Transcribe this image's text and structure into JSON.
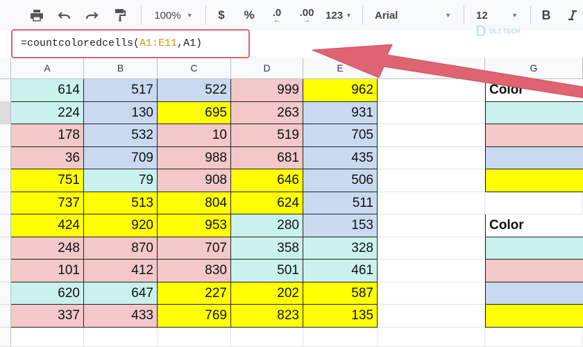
{
  "toolbar": {
    "zoom": "100%",
    "currency": "$",
    "percent": "%",
    "decrease_decimal": ".0",
    "increase_decimal": ".00",
    "more_formats": "123",
    "font": "Arial",
    "font_size": "12",
    "bold": "B"
  },
  "formula_bar": {
    "prefix": "=countcoloredcells(",
    "range": "A1:E11",
    "separator": ",",
    "color_ref": "A1",
    "suffix": ")"
  },
  "watermark": {
    "mark": "D",
    "text": "DLZ TECH"
  },
  "columns": [
    "A",
    "B",
    "C",
    "D",
    "E",
    "F",
    "G"
  ],
  "colors": {
    "cyan": "#c9f2ec",
    "blue": "#c9daf0",
    "pink": "#f2c8c8",
    "yellow": "#ffff00",
    "arrow": "#e06371"
  },
  "grid": [
    [
      {
        "v": "614",
        "c": "cyan"
      },
      {
        "v": "517",
        "c": "blue"
      },
      {
        "v": "522",
        "c": "blue"
      },
      {
        "v": "999",
        "c": "pink"
      },
      {
        "v": "962",
        "c": "yellow"
      }
    ],
    [
      {
        "v": "224",
        "c": "cyan"
      },
      {
        "v": "130",
        "c": "blue"
      },
      {
        "v": "695",
        "c": "yellow"
      },
      {
        "v": "263",
        "c": "pink"
      },
      {
        "v": "931",
        "c": "blue"
      }
    ],
    [
      {
        "v": "178",
        "c": "pink"
      },
      {
        "v": "532",
        "c": "blue"
      },
      {
        "v": "10",
        "c": "pink"
      },
      {
        "v": "519",
        "c": "pink"
      },
      {
        "v": "705",
        "c": "blue"
      }
    ],
    [
      {
        "v": "36",
        "c": "pink"
      },
      {
        "v": "709",
        "c": "blue"
      },
      {
        "v": "988",
        "c": "pink"
      },
      {
        "v": "681",
        "c": "pink"
      },
      {
        "v": "435",
        "c": "blue"
      }
    ],
    [
      {
        "v": "751",
        "c": "yellow"
      },
      {
        "v": "79",
        "c": "cyan"
      },
      {
        "v": "908",
        "c": "pink"
      },
      {
        "v": "646",
        "c": "yellow"
      },
      {
        "v": "506",
        "c": "blue"
      }
    ],
    [
      {
        "v": "737",
        "c": "yellow"
      },
      {
        "v": "513",
        "c": "yellow"
      },
      {
        "v": "804",
        "c": "yellow"
      },
      {
        "v": "624",
        "c": "yellow"
      },
      {
        "v": "511",
        "c": "blue"
      }
    ],
    [
      {
        "v": "424",
        "c": "yellow"
      },
      {
        "v": "920",
        "c": "yellow"
      },
      {
        "v": "953",
        "c": "yellow"
      },
      {
        "v": "280",
        "c": "cyan"
      },
      {
        "v": "153",
        "c": "blue"
      }
    ],
    [
      {
        "v": "248",
        "c": "pink"
      },
      {
        "v": "870",
        "c": "pink"
      },
      {
        "v": "707",
        "c": "pink"
      },
      {
        "v": "358",
        "c": "cyan"
      },
      {
        "v": "328",
        "c": "cyan"
      }
    ],
    [
      {
        "v": "101",
        "c": "pink"
      },
      {
        "v": "412",
        "c": "pink"
      },
      {
        "v": "830",
        "c": "pink"
      },
      {
        "v": "501",
        "c": "cyan"
      },
      {
        "v": "461",
        "c": "cyan"
      }
    ],
    [
      {
        "v": "620",
        "c": "cyan"
      },
      {
        "v": "647",
        "c": "cyan"
      },
      {
        "v": "227",
        "c": "yellow"
      },
      {
        "v": "202",
        "c": "yellow"
      },
      {
        "v": "587",
        "c": "yellow"
      }
    ],
    [
      {
        "v": "337",
        "c": "pink"
      },
      {
        "v": "433",
        "c": "pink"
      },
      {
        "v": "769",
        "c": "yellow"
      },
      {
        "v": "823",
        "c": "yellow"
      },
      {
        "v": "135",
        "c": "yellow"
      }
    ]
  ],
  "g_column": [
    {
      "text": "Color",
      "c": "white"
    },
    {
      "text": "",
      "c": "cyan"
    },
    {
      "text": "",
      "c": "pink"
    },
    {
      "text": "",
      "c": "blue"
    },
    {
      "text": "",
      "c": "yellow"
    },
    null,
    {
      "text": "Color",
      "c": "white"
    },
    {
      "text": "",
      "c": "cyan"
    },
    {
      "text": "",
      "c": "pink"
    },
    {
      "text": "",
      "c": "blue"
    },
    {
      "text": "",
      "c": "yellow"
    }
  ]
}
